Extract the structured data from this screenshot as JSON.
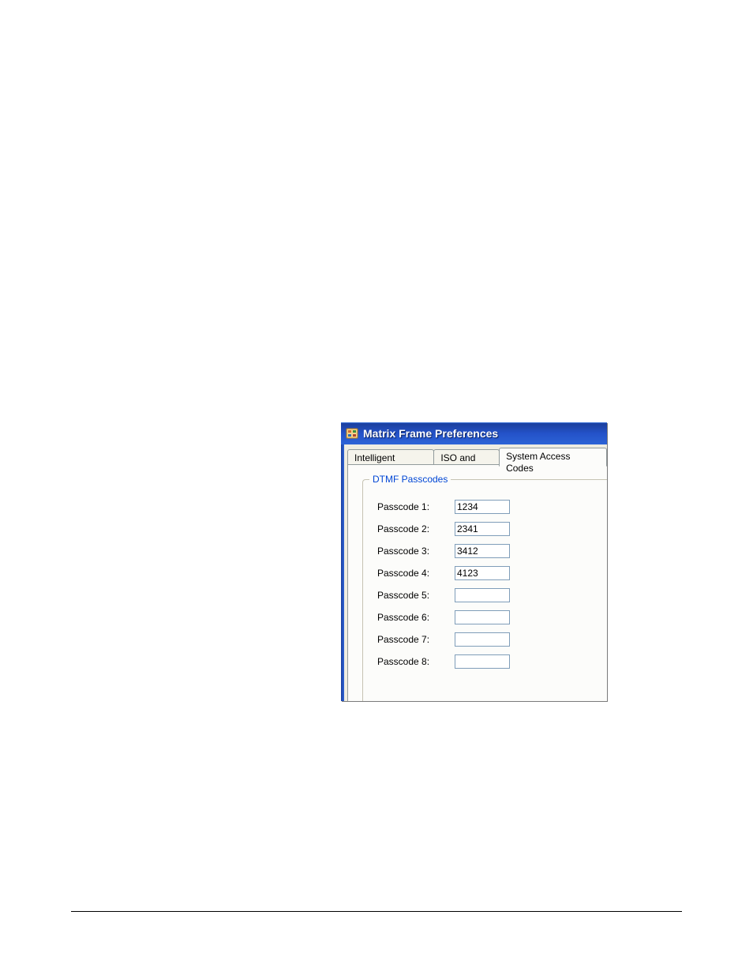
{
  "dialog": {
    "title": "Matrix Frame Preferences",
    "tabs": [
      {
        "label": "Intelligent Linking",
        "active": false
      },
      {
        "label": "ISO and IFB",
        "active": false
      },
      {
        "label": "System Access Codes",
        "active": true
      }
    ],
    "group_title": "DTMF Passcodes",
    "passcodes": [
      {
        "label": "Passcode 1:",
        "value": "1234"
      },
      {
        "label": "Passcode 2:",
        "value": "2341"
      },
      {
        "label": "Passcode 3:",
        "value": "3412"
      },
      {
        "label": "Passcode 4:",
        "value": "4123"
      },
      {
        "label": "Passcode 5:",
        "value": ""
      },
      {
        "label": "Passcode 6:",
        "value": ""
      },
      {
        "label": "Passcode 7:",
        "value": ""
      },
      {
        "label": "Passcode 8:",
        "value": ""
      }
    ]
  }
}
